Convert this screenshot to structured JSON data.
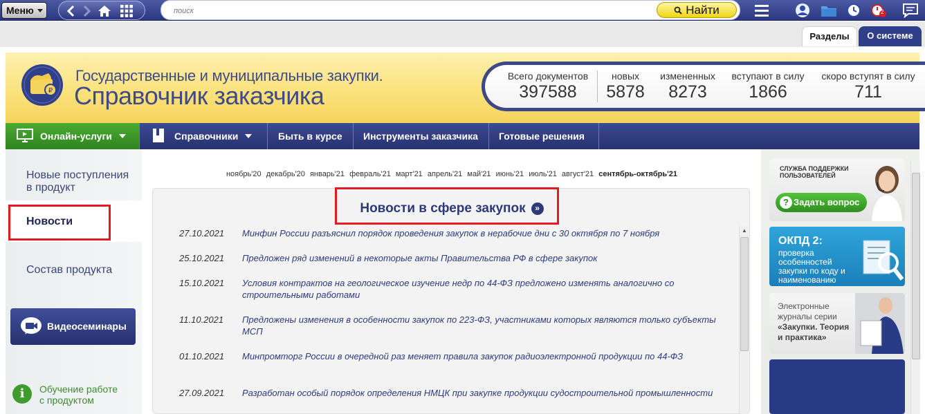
{
  "toolbar": {
    "menu_label": "Меню",
    "search_placeholder": "поиск",
    "find_label": "Найти",
    "badge_count": "2"
  },
  "tabs": {
    "razdely": "Разделы",
    "about": "О системе"
  },
  "banner": {
    "title_line1": "Государственные и муниципальные закупки.",
    "title_line2": "Справочник заказчика",
    "stats": [
      {
        "label": "Всего документов",
        "value": "397588"
      },
      {
        "label": "новых",
        "value": "5878"
      },
      {
        "label": "измененных",
        "value": "8273"
      },
      {
        "label": "вступают в силу",
        "value": "1866"
      },
      {
        "label": "скоро вступят в силу",
        "value": "711"
      }
    ]
  },
  "mainnav": [
    {
      "label": "Онлайн-услуги"
    },
    {
      "label": "Справочники"
    },
    {
      "label": "Быть в курсе"
    },
    {
      "label": "Инструменты заказчика"
    },
    {
      "label": "Готовые решения"
    }
  ],
  "left": {
    "new_items": "Новые поступления в продукт",
    "news": "Новости",
    "composition": "Состав продукта",
    "video": "Видеосеминары",
    "training_line1": "Обучение работе",
    "training_line2": "с продуктом"
  },
  "months": [
    "ноябрь'20",
    "декабрь'20",
    "январь'21",
    "февраль'21",
    "март'21",
    "апрель'21",
    "май'21",
    "июнь'21",
    "июль'21",
    "август'21",
    "сентябрь-октябрь'21"
  ],
  "news_title": "Новости в сфере закупок",
  "news": [
    {
      "date": "27.10.2021",
      "text": "Минфин России разъяснил порядок проведения закупок в нерабочие дни с 30 октября по 7 ноября"
    },
    {
      "date": "25.10.2021",
      "text": "Предложен ряд изменений в некоторые акты Правительства РФ в сфере закупок"
    },
    {
      "date": "15.10.2021",
      "text": "Условия контрактов на геологическое изучение недр по 44-ФЗ предложено изменять аналогично со строительными работами"
    },
    {
      "date": "11.10.2021",
      "text": "Предложены изменения в особенности закупок по 223-ФЗ, участниками которых являются только субъекты МСП"
    },
    {
      "date": "01.10.2021",
      "text": "Минпромторг России в очередной раз меняет правила закупок радиоэлектронной продукции по 44-ФЗ"
    },
    {
      "date": "27.09.2021",
      "text": "Разработан особый порядок определения НМЦК при закупке продукции судостроительной промышленности"
    }
  ],
  "right": {
    "support_small": "СЛУЖБА ПОДДЕРЖКИ ПОЛЬЗОВАТЕЛЕЙ",
    "ask_label": "Задать вопрос",
    "okpd_title": "ОКПД 2:",
    "okpd_text": "проверка особенностей закупки по коду и наименованию",
    "journal_text": "Электронные журналы серии",
    "journal_name": "«Закупки. Теория и практика»"
  },
  "colors": {
    "accent_navy": "#2f3f8a",
    "online_green": "#3f9b2c",
    "highlight_red": "#e01b24",
    "banner_yellow": "#fbe27d"
  }
}
